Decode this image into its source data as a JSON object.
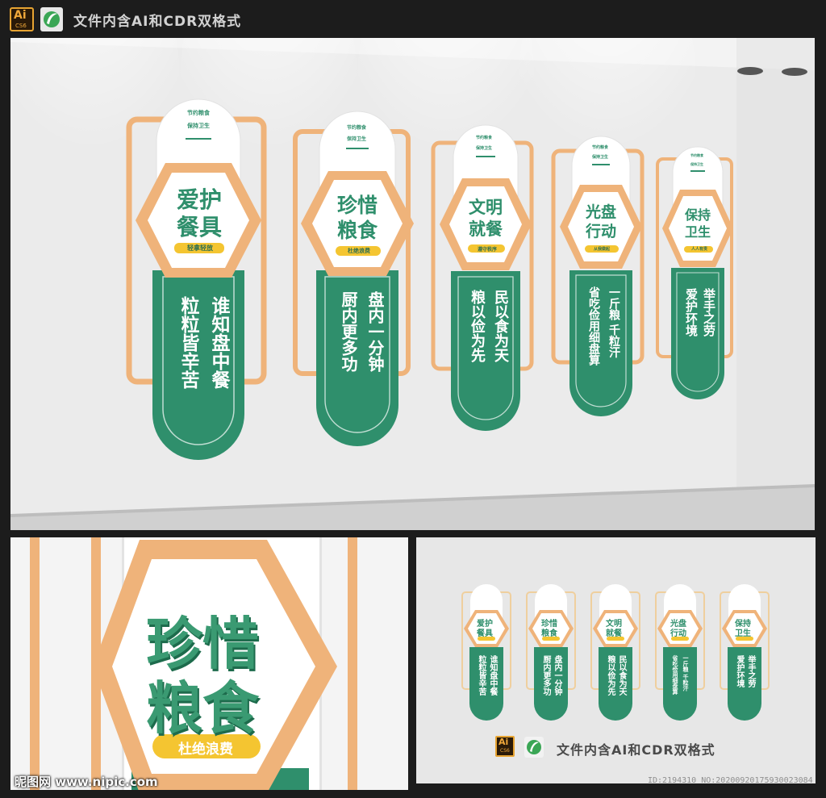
{
  "header": {
    "ai_badge_label": "Ai",
    "ai_badge_sub": "CS6",
    "title": "文件内含AI和CDR双格式"
  },
  "colors": {
    "green": "#2f8f6c",
    "orange": "#efb37a",
    "white": "#ffffff"
  },
  "panels": [
    {
      "small_top_line1": "节约粮食",
      "small_top_line2": "保持卫生",
      "title_line1": "爱护",
      "title_line2": "餐具",
      "tag": "轻拿轻放",
      "verse_col1": "谁知盘中餐",
      "verse_col2": "粒粒皆辛苦"
    },
    {
      "small_top_line1": "节约粮食",
      "small_top_line2": "保持卫生",
      "title_line1": "珍惜",
      "title_line2": "粮食",
      "tag": "杜绝浪费",
      "verse_col1": "盘内一分钟",
      "verse_col2": "厨内更多功"
    },
    {
      "small_top_line1": "节约粮食",
      "small_top_line2": "保持卫生",
      "title_line1": "文明",
      "title_line2": "就餐",
      "tag": "遵守秩序",
      "verse_col1": "民以食为天",
      "verse_col2": "粮以俭为先"
    },
    {
      "small_top_line1": "节约粮食",
      "small_top_line2": "保持卫生",
      "title_line1": "光盘",
      "title_line2": "行动",
      "tag": "从我做起",
      "verse_col1": "一斤粮 千粒汗",
      "verse_col2": "省吃俭用细盘算"
    },
    {
      "small_top_line1": "节约粮食",
      "small_top_line2": "保持卫生",
      "title_line1": "保持",
      "title_line2": "卫生",
      "tag": "人人有责",
      "verse_col1": "举手之劳",
      "verse_col2": "爱护环境"
    }
  ],
  "zoom": {
    "title_line1": "珍惜",
    "title_line2": "粮食",
    "tag": "杜绝浪费",
    "site_logo": "昵图网 www.nipic.com"
  },
  "overview": {
    "ai_label": "Ai",
    "ai_sub": "CS6",
    "title": "文件内含AI和CDR双格式"
  },
  "watermark_id": "ID:2194310 NO:20200920175930023084"
}
